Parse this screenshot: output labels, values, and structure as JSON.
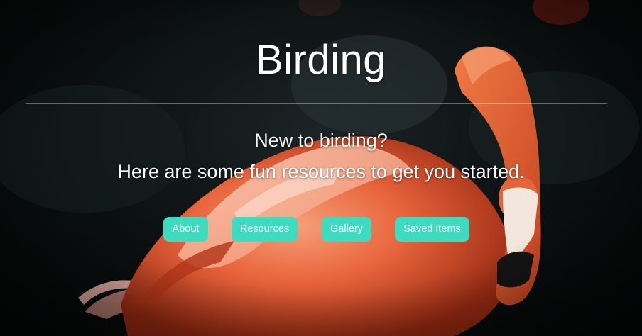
{
  "header": {
    "title": "Birding"
  },
  "hero": {
    "tagline_line1": "New to birding?",
    "tagline_line2": "Here are some fun resources to get you started.",
    "background_image": "flamingo-photo",
    "accent_color": "#3ddbc0"
  },
  "nav": {
    "items": [
      {
        "label": "About"
      },
      {
        "label": "Resources"
      },
      {
        "label": "Gallery"
      },
      {
        "label": "Saved Items"
      }
    ]
  }
}
